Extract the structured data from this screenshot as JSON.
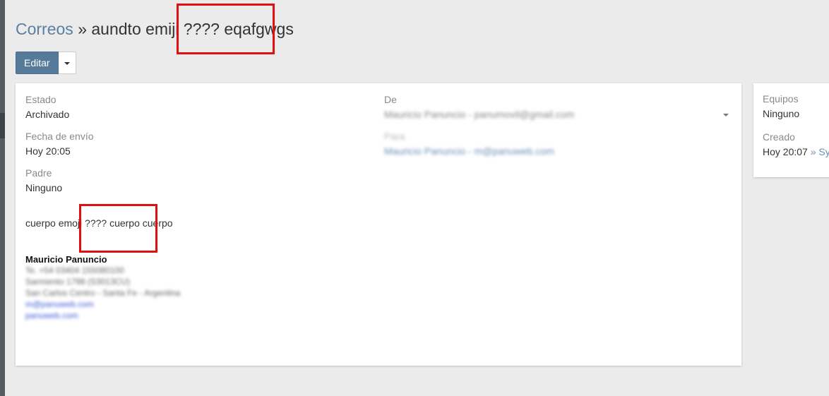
{
  "breadcrumb": {
    "parent": "Correos",
    "separator": "»",
    "current": "aundto emiji ???? eqafgwgs"
  },
  "actions": {
    "edit_label": "Editar"
  },
  "details": {
    "estado_label": "Estado",
    "estado_value": "Archivado",
    "fecha_label": "Fecha de envío",
    "fecha_value": "Hoy 20:05",
    "padre_label": "Padre",
    "padre_value": "Ninguno",
    "de_label": "De",
    "de_value": "Mauricio Panuncio - panumovil@gmail.com",
    "para_label": "Para",
    "para_value": "Mauricio Panuncio - m@panuweb.com"
  },
  "body": {
    "text": "cuerpo emoji ???? cuerpo cuerpo"
  },
  "signature": {
    "name": "Mauricio Panuncio",
    "phone": "Te. +54 03404 155080100",
    "address": "Sarmiento 1798 (S3013CU)",
    "city": "San Carlos Centro - Santa Fe - Argentina",
    "email": "m@panuweb.com",
    "site": "panuweb.com"
  },
  "side": {
    "equipos_label": "Equipos",
    "equipos_value": "Ninguno",
    "creado_label": "Creado",
    "creado_value": "Hoy 20:07",
    "creado_by": " » Sy"
  },
  "colors": {
    "primary": "#567a9a",
    "link": "#5a7fa3",
    "highlight": "#e01010"
  }
}
